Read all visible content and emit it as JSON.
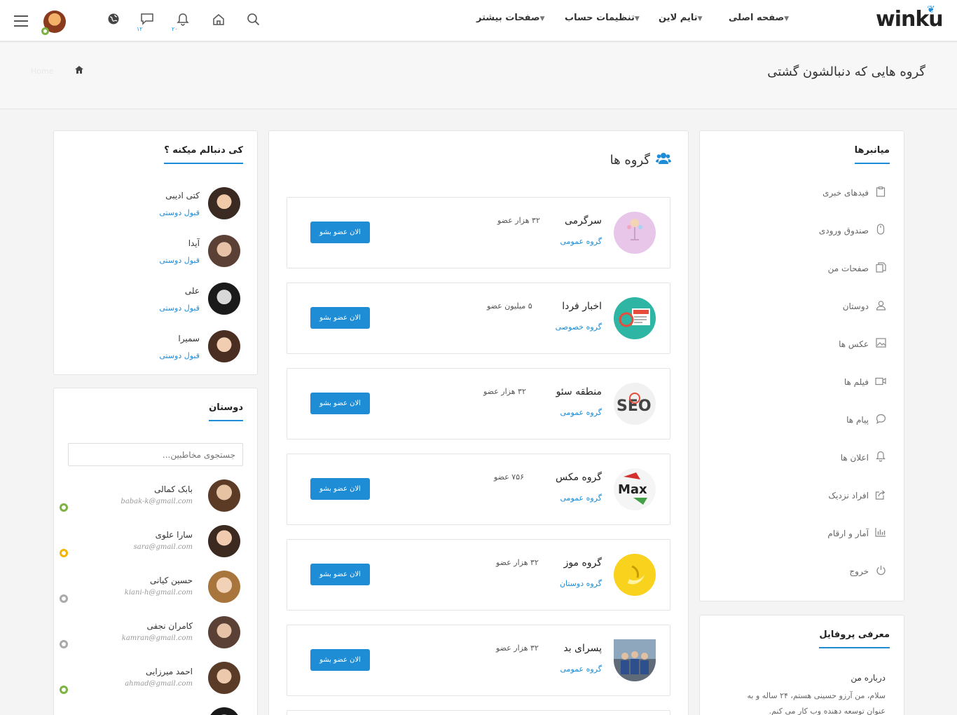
{
  "header": {
    "logo": "winku",
    "nav": [
      {
        "label": "صفحه اصلی"
      },
      {
        "label": "تایم لاین"
      },
      {
        "label": "تنظیمات حساب"
      },
      {
        "label": "صفحات بیشتر"
      }
    ],
    "messages_count": "۱۲",
    "notifications_count": "۲۰"
  },
  "page": {
    "title": "گروه هایی که دنبالشون گشتی",
    "breadcrumb_ghost": "Home"
  },
  "shortcuts": {
    "title": "میانبرها",
    "items": [
      {
        "label": "فیدهای خبری",
        "icon": "clipboard-icon"
      },
      {
        "label": "صندوق ورودی",
        "icon": "mouse-icon"
      },
      {
        "label": "صفحات من",
        "icon": "files-icon"
      },
      {
        "label": "دوستان",
        "icon": "user-icon"
      },
      {
        "label": "عکس ها",
        "icon": "image-icon"
      },
      {
        "label": "فیلم ها",
        "icon": "video-icon"
      },
      {
        "label": "پیام ها",
        "icon": "comment-icon"
      },
      {
        "label": "اعلان ها",
        "icon": "bell-icon"
      },
      {
        "label": "افراد نزدیک",
        "icon": "share-icon"
      },
      {
        "label": "آمار و ارقام",
        "icon": "chart-icon"
      },
      {
        "label": "خروج",
        "icon": "power-icon"
      }
    ]
  },
  "profile_intro": {
    "title": "معرفی پروفایل",
    "about_title": "درباره من",
    "about_line1": "سلام، من آرزو حسینی هستم، ۲۴ ساله و به",
    "about_line2": "عنوان توسعه دهنده وب کار می کنم."
  },
  "groups": {
    "title": "گروه ها",
    "join_label": "الان عضو بشو",
    "items": [
      {
        "name": "سرگرمی",
        "type": "گروه عمومی",
        "members": "۳۲ هزار عضو",
        "color": "#e7c6ea"
      },
      {
        "name": "اخبار فردا",
        "type": "گروه خصوصی",
        "members": "۵ میلیون عضو",
        "color": "#2fb5a3"
      },
      {
        "name": "منطقه سئو",
        "type": "گروه عمومی",
        "members": "۳۲ هزار عضو",
        "color": "#f1f1f1"
      },
      {
        "name": "گروه مکس",
        "type": "گروه عمومی",
        "members": "۷۵۶ عضو",
        "color": "#f5f5f5"
      },
      {
        "name": "گروه موز",
        "type": "گروه دوستان",
        "members": "۳۲ هزار عضو",
        "color": "#f8d21c"
      },
      {
        "name": "پسرای بد",
        "type": "گروه عمومی",
        "members": "۳۲ هزار عضو",
        "color": "#5f6b78"
      }
    ]
  },
  "followers": {
    "title": "کی دنبالم میکنه ؟",
    "action_label": "قبول دوستی",
    "items": [
      {
        "name": "کتی ادیبی"
      },
      {
        "name": "آیدا"
      },
      {
        "name": "علی"
      },
      {
        "name": "سمیرا"
      }
    ]
  },
  "friends": {
    "title": "دوستان",
    "search_placeholder": "جستجوی مخاطبین...",
    "items": [
      {
        "name": "بابک کمالی",
        "email": "babak-k@gmail.com",
        "status_color": "#7cb342"
      },
      {
        "name": "سارا علوی",
        "email": "sara@gmail.com",
        "status_color": "#f5b400"
      },
      {
        "name": "حسین کیانی",
        "email": "kiani-h@gmail.com",
        "status_color": "#aaaaaa"
      },
      {
        "name": "کامران نجفی",
        "email": "kamran@gmail.com",
        "status_color": "#aaaaaa"
      },
      {
        "name": "احمد میرزایی",
        "email": "ahmad@gmail.com",
        "status_color": "#7cb342"
      }
    ]
  }
}
